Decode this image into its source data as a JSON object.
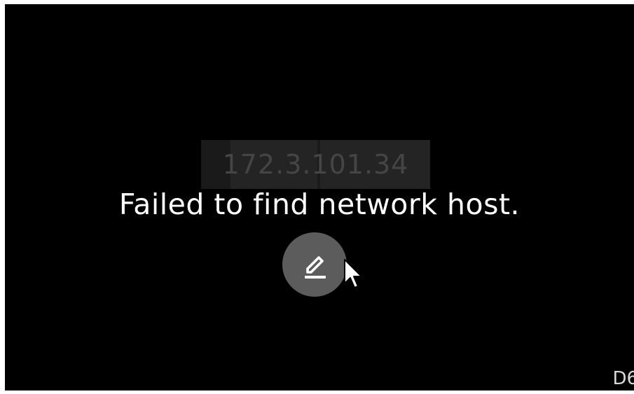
{
  "remote_screen": {
    "host_address": "172.3.101.34",
    "message": "Failed to find network host.",
    "edit_button": {
      "icon": "pencil-edit-icon"
    },
    "corner_label": "D6"
  },
  "colors": {
    "background": "#000000",
    "message_text": "#ffffff",
    "address_box": "#1a1a1a",
    "address_text": "#454545",
    "edit_button": "#5c5c5c"
  }
}
